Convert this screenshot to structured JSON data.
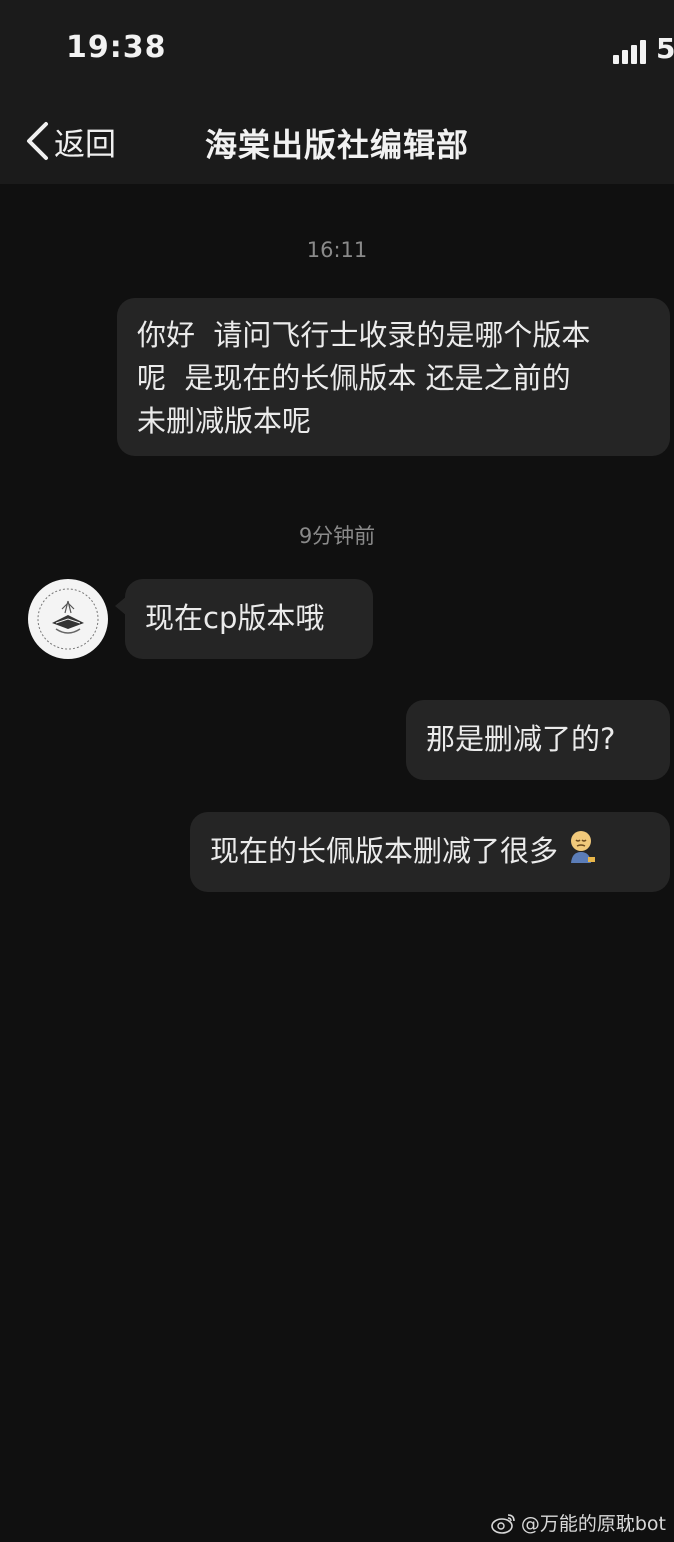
{
  "status_bar": {
    "time": "19:38",
    "battery": "5"
  },
  "nav": {
    "back_label": "返回",
    "title": "海棠出版社编辑部"
  },
  "messages": [
    {
      "type": "timestamp",
      "text": "16:11"
    },
    {
      "type": "outgoing",
      "lines": [
        "你好  请问飞行士收录的是哪个版本",
        "呢  是现在的长佩版本 还是之前的",
        "未删减版本呢"
      ]
    },
    {
      "type": "timestamp",
      "text": "9分钟前"
    },
    {
      "type": "incoming",
      "text": "现在cp版本哦"
    },
    {
      "type": "outgoing",
      "text": "那是删减了的?"
    },
    {
      "type": "outgoing",
      "text": "现在的长佩版本删减了很多",
      "emoji": "sad-face-emoji"
    }
  ],
  "watermark": {
    "text": "@万能的原耽bot",
    "icon": "weibo-icon"
  },
  "colors": {
    "background": "#101010",
    "bar": "#1b1b1b",
    "bubble": "#252525",
    "text": "#ebebeb",
    "timestamp": "#8a8a8a"
  }
}
